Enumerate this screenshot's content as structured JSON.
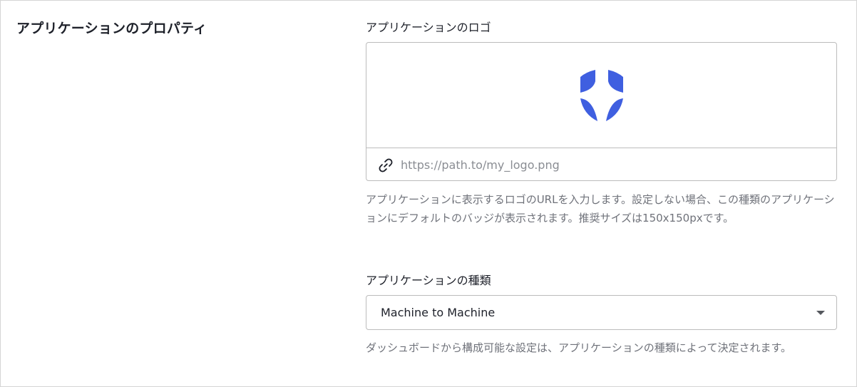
{
  "section": {
    "title": "アプリケーションのプロパティ"
  },
  "logo_field": {
    "label": "アプリケーションのロゴ",
    "url_placeholder": "https://path.to/my_logo.png",
    "url_value": "",
    "help": "アプリケーションに表示するロゴのURLを入力します。設定しない場合、この種類のアプリケーションにデフォルトのバッジが表示されます。推奨サイズは150x150pxです。",
    "logo_icon": "shield-logo-icon",
    "link_icon": "link-icon"
  },
  "type_field": {
    "label": "アプリケーションの種類",
    "selected": "Machine to Machine",
    "help": "ダッシュボードから構成可能な設定は、アプリケーションの種類によって決定されます。"
  },
  "colors": {
    "logo_blue": "#3f5fe0",
    "border": "#bcbcbc",
    "help_text": "#6f727a",
    "title_text": "#1e212a"
  }
}
